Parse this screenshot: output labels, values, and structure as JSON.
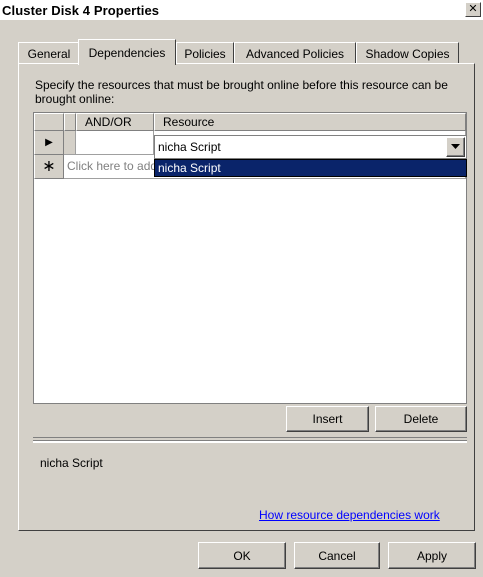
{
  "window": {
    "title": "Cluster Disk 4 Properties",
    "close_glyph": "✕"
  },
  "tabs": [
    {
      "label": "General"
    },
    {
      "label": "Dependencies"
    },
    {
      "label": "Policies"
    },
    {
      "label": "Advanced Policies"
    },
    {
      "label": "Shadow Copies"
    }
  ],
  "active_tab": "Dependencies",
  "description": "Specify the resources that must be brought online before this resource can be brought online:",
  "grid": {
    "columns": [
      "AND/OR",
      "Resource"
    ],
    "rows": [
      {
        "marker": "▶",
        "and_or": "",
        "resource": "nicha Script"
      }
    ],
    "new_row": {
      "marker": "∗",
      "placeholder": "Click here to add a dependency"
    }
  },
  "combo": {
    "value": "nicha Script",
    "options": [
      "nicha Script"
    ],
    "highlighted": "nicha Script"
  },
  "buttons": {
    "insert": "Insert",
    "delete": "Delete",
    "ok": "OK",
    "cancel": "Cancel",
    "apply": "Apply"
  },
  "selected_resource": "nicha Script",
  "help_link": "How resource dependencies work",
  "colors": {
    "dialog_bg": "#d4d0c8",
    "selection": "#0a246a",
    "link": "#0000ff"
  }
}
